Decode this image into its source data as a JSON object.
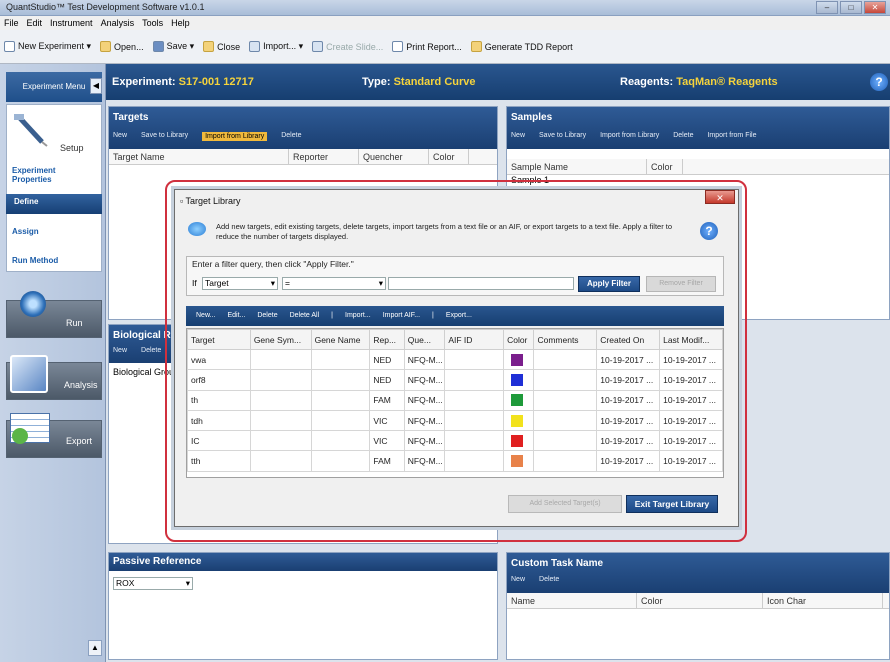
{
  "window": {
    "title": "QuantStudio™ Test Development Software v1.0.1"
  },
  "menu": [
    "File",
    "Edit",
    "Instrument",
    "Analysis",
    "Tools",
    "Help"
  ],
  "toolbar": {
    "new_experiment": "New Experiment ▾",
    "open": "Open...",
    "save": "Save ▾",
    "close": "Close",
    "import": "Import... ▾",
    "create_slide": "Create Slide...",
    "print_report": "Print Report...",
    "generate_tdd": "Generate TDD Report"
  },
  "sidebar": {
    "header": "Experiment Menu",
    "setup": "Setup",
    "links": [
      "Experiment Properties",
      "Define",
      "Assign",
      "Run Method"
    ],
    "run": "Run",
    "analysis": "Analysis",
    "export": "Export"
  },
  "experiment": {
    "label": "Experiment:",
    "name": "S17-001 12717",
    "type_label": "Type:",
    "type": "Standard Curve",
    "reagents_label": "Reagents:",
    "reagents": "TaqMan® Reagents"
  },
  "targets_panel": {
    "title": "Targets",
    "tools": [
      "New",
      "Save to Library",
      "Import from Library",
      "Delete"
    ],
    "columns": [
      "Target Name",
      "Reporter",
      "Quencher",
      "Color"
    ]
  },
  "samples_panel": {
    "title": "Samples",
    "tools": [
      "New",
      "Save to Library",
      "Import from Library",
      "Delete",
      "Import from File"
    ],
    "columns": [
      "Sample Name",
      "Color"
    ],
    "row0": "Sample 1"
  },
  "bio_panel": {
    "title": "Biological Re",
    "tools": [
      "New",
      "Delete"
    ],
    "row0": "Biological Grou"
  },
  "passive_panel": {
    "title": "Passive Reference",
    "value": "ROX"
  },
  "custom_panel": {
    "title": "Custom Task Name",
    "tools": [
      "New",
      "Delete"
    ],
    "columns": [
      "Name",
      "Color",
      "Icon Char"
    ]
  },
  "dialog": {
    "title": "Target Library",
    "close": "✕",
    "info": "Add new targets, edit existing targets, delete targets, import targets from a text file or an AIF, or export targets to a text file. Apply a filter to reduce the number of targets displayed.",
    "filter_caption": "Enter a filter query, then click \"Apply Filter.\"",
    "filter_if": "If",
    "filter_field": "Target",
    "filter_op": "=",
    "filter_value": "",
    "apply_filter": "Apply Filter",
    "remove_filter": "Remove Filter",
    "tools": [
      "New...",
      "Edit...",
      "Delete",
      "Delete All",
      "|",
      "Import...",
      "Import AIF...",
      "|",
      "Export..."
    ],
    "columns": [
      "Target",
      "Gene Sym...",
      "Gene Name",
      "Rep...",
      "Que...",
      "AIF ID",
      "Color",
      "Comments",
      "Created On",
      "Last Modif..."
    ],
    "rows": [
      {
        "target": "vwa",
        "gene_sym": "",
        "gene_name": "",
        "reporter": "NED",
        "quencher": "NFQ-M...",
        "aif": "",
        "color": "#7a1e8c",
        "comments": "",
        "created": "10-19-2017 ...",
        "modified": "10-19-2017 ..."
      },
      {
        "target": "orf8",
        "gene_sym": "",
        "gene_name": "",
        "reporter": "NED",
        "quencher": "NFQ-M...",
        "aif": "",
        "color": "#1f2fd6",
        "comments": "",
        "created": "10-19-2017 ...",
        "modified": "10-19-2017 ..."
      },
      {
        "target": "th",
        "gene_sym": "",
        "gene_name": "",
        "reporter": "FAM",
        "quencher": "NFQ-M...",
        "aif": "",
        "color": "#1e9a3a",
        "comments": "",
        "created": "10-19-2017 ...",
        "modified": "10-19-2017 ..."
      },
      {
        "target": "tdh",
        "gene_sym": "",
        "gene_name": "",
        "reporter": "VIC",
        "quencher": "NFQ-M...",
        "aif": "",
        "color": "#f2e21c",
        "comments": "",
        "created": "10-19-2017 ...",
        "modified": "10-19-2017 ..."
      },
      {
        "target": "IC",
        "gene_sym": "",
        "gene_name": "",
        "reporter": "VIC",
        "quencher": "NFQ-M...",
        "aif": "",
        "color": "#e02020",
        "comments": "",
        "created": "10-19-2017 ...",
        "modified": "10-19-2017 ..."
      },
      {
        "target": "tth",
        "gene_sym": "",
        "gene_name": "",
        "reporter": "FAM",
        "quencher": "NFQ-M...",
        "aif": "",
        "color": "#e8824a",
        "comments": "",
        "created": "10-19-2017 ...",
        "modified": "10-19-2017 ..."
      }
    ],
    "add_selected": "Add Selected Target(s)",
    "exit": "Exit Target Library"
  }
}
